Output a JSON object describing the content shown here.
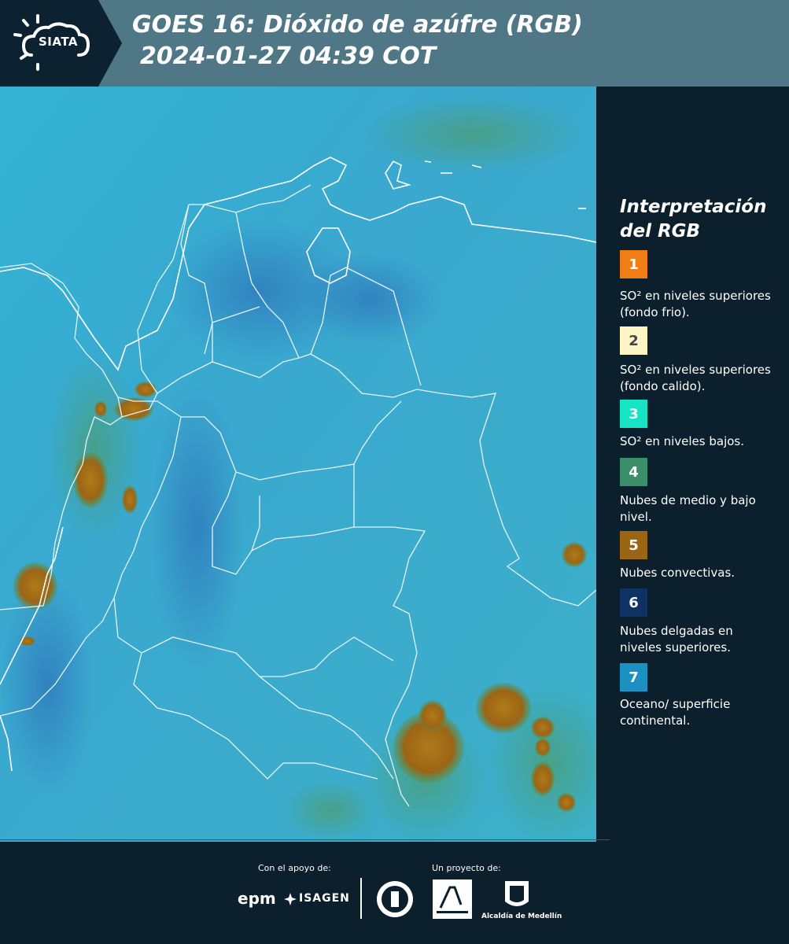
{
  "header": {
    "logo_text": "SIATA",
    "title_line1": "GOES 16: Dióxido de azúfre (RGB)",
    "title_line2": "2024-01-27 04:39 COT"
  },
  "legend": {
    "title_line1": "Interpretación",
    "title_line2": "del RGB",
    "items": [
      {
        "number": "1",
        "color": "#f07d16",
        "description": "SO² en niveles superiores (fondo frio)."
      },
      {
        "number": "2",
        "color": "#fdf5c4",
        "description": "SO² en niveles superiores (fondo calido)."
      },
      {
        "number": "3",
        "color": "#17e3c5",
        "description": "SO² en niveles bajos."
      },
      {
        "number": "4",
        "color": "#3a8f6a",
        "description": "Nubes de medio y bajo nivel."
      },
      {
        "number": "5",
        "color": "#9b6516",
        "description": "Nubes convectivas."
      },
      {
        "number": "6",
        "color": "#0d3263",
        "description": "Nubes delgadas en niveles superiores."
      },
      {
        "number": "7",
        "color": "#1a91c2",
        "description": "Oceano/ superficie continental."
      }
    ]
  },
  "footer": {
    "support_label": "Con el apoyo de:",
    "project_label": "Un proyecto de:",
    "sponsor1": "epm",
    "sponsor2": "ISAGEN",
    "partner_amva": "Área Metropolitana Valle de Aburrá",
    "partner_alcaldia": "Alcaldía de Medellín"
  },
  "colors": {
    "map_background": "#3aaed0",
    "convective_clouds": "#9b6516",
    "header_bg": "#4f7786",
    "panel_bg": "#0c1f2c"
  }
}
